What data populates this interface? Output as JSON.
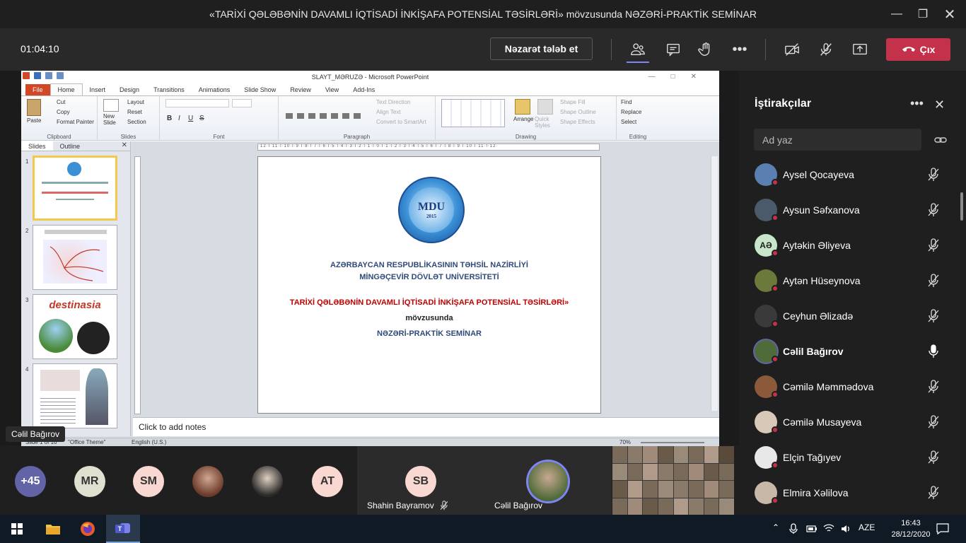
{
  "window": {
    "title": "«TARİXİ QƏLƏBƏNİN DAVAMLI İQTİSADİ İNKİŞAFA POTENSİAL TƏSİRLƏRİ» mövzusunda NƏZƏRİ-PRAKTİK SEMİNAR"
  },
  "meeting": {
    "timer": "01:04:10",
    "request_control_label": "Nəzarət tələb et",
    "leave_label": "Çıx"
  },
  "ppt": {
    "title": "SLAYT_MƏRUZƏ  -  Microsoft PowerPoint",
    "tabs": [
      "File",
      "Home",
      "Insert",
      "Design",
      "Transitions",
      "Animations",
      "Slide Show",
      "Review",
      "View",
      "Add-Ins"
    ],
    "clipboard": {
      "paste": "Paste",
      "cut": "Cut",
      "copy": "Copy",
      "format_painter": "Format Painter",
      "label": "Clipboard"
    },
    "slides_group": {
      "new_slide": "New Slide",
      "layout": "Layout",
      "reset": "Reset",
      "section": "Section",
      "label": "Slides"
    },
    "font_label": "Font",
    "paragraph": {
      "text_direction": "Text Direction",
      "align_text": "Align Text",
      "convert": "Convert to SmartArt",
      "label": "Paragraph"
    },
    "drawing": {
      "arrange": "Arrange",
      "quick_styles": "Quick Styles",
      "shape_fill": "Shape Fill",
      "shape_outline": "Shape Outline",
      "shape_effects": "Shape Effects",
      "label": "Drawing"
    },
    "editing": {
      "find": "Find",
      "replace": "Replace",
      "select": "Select",
      "label": "Editing"
    },
    "pane_tabs": [
      "Slides",
      "Outline"
    ],
    "thumb_numbers": [
      "1",
      "2",
      "3",
      "4"
    ],
    "thumb3_text": "destinasia",
    "slide": {
      "line1": "AZƏRBAYCAN  RESPUBLİKASININ  TƏHSİL NAZİRLİYİ",
      "line2": "MİNGƏÇEVİR DÖVLƏT UNİVERSİTETİ",
      "line3": "TARİXİ QƏLƏBƏNİN DAVAMLI İQTİSADİ İNKİŞAFA POTENSİAL TƏSİRLƏRİ»",
      "line4": "mövzusunda",
      "line5": "NƏZƏRİ-PRAKTİK  SEMİNAR",
      "logo_text": "MDU",
      "logo_year": "2015"
    },
    "notes_placeholder": "Click to add notes",
    "status": {
      "slide": "Slide 1 of 16",
      "theme": "\"Office Theme\"",
      "language": "English (U.S.)",
      "zoom": "70%"
    }
  },
  "overlay_name": "Cəlil Bağırov",
  "panel": {
    "title": "İştirakçılar",
    "search_placeholder": "Ad yaz",
    "participants": [
      {
        "name": "Aysel Qocayeva",
        "initials": "",
        "avatar_color": "#5a7fb0"
      },
      {
        "name": "Aysun Səfxanova",
        "initials": "",
        "avatar_color": "#4a5a6a"
      },
      {
        "name": "Aytəkin Əliyeva",
        "initials": "AƏ",
        "avatar_color": "#c8e6c9"
      },
      {
        "name": "Aytən Hüseynova",
        "initials": "",
        "avatar_color": "#6b7a3a"
      },
      {
        "name": "Ceyhun Əlizadə",
        "initials": "",
        "avatar_color": "#3a3a3a"
      },
      {
        "name": "Cəlil Bağırov",
        "initials": "",
        "avatar_color": "#4f6b3a"
      },
      {
        "name": "Cəmilə Məmmədova",
        "initials": "",
        "avatar_color": "#8a5a3a"
      },
      {
        "name": "Cəmilə Musayeva",
        "initials": "",
        "avatar_color": "#d8c8b8"
      },
      {
        "name": "Elçin Tağıyev",
        "initials": "",
        "avatar_color": "#e8e8e8"
      },
      {
        "name": "Elmira Xəlilova",
        "initials": "",
        "avatar_color": "#c8b8a8"
      }
    ]
  },
  "strip": {
    "overflow": "+45",
    "circles": [
      {
        "initials": "MR",
        "color": "#e0e0d0"
      },
      {
        "initials": "SM",
        "color": "#f8d8d0"
      },
      {
        "initials": "",
        "color": "#8a5a4a"
      },
      {
        "initials": "",
        "color": "#d8d0c8"
      },
      {
        "initials": "AT",
        "color": "#f8d8d0"
      }
    ],
    "tile1": {
      "initials": "SB",
      "name": "Shahin Bayramov"
    },
    "tile2": {
      "name": "Cəlil Bağırov"
    }
  },
  "taskbar": {
    "lang": "AZE",
    "time": "16:43",
    "date": "28/12/2020"
  },
  "colors": {
    "accent": "#6264a7",
    "leave": "#c4314b",
    "slide_red": "#c00000",
    "slide_blue": "#1f3864"
  }
}
